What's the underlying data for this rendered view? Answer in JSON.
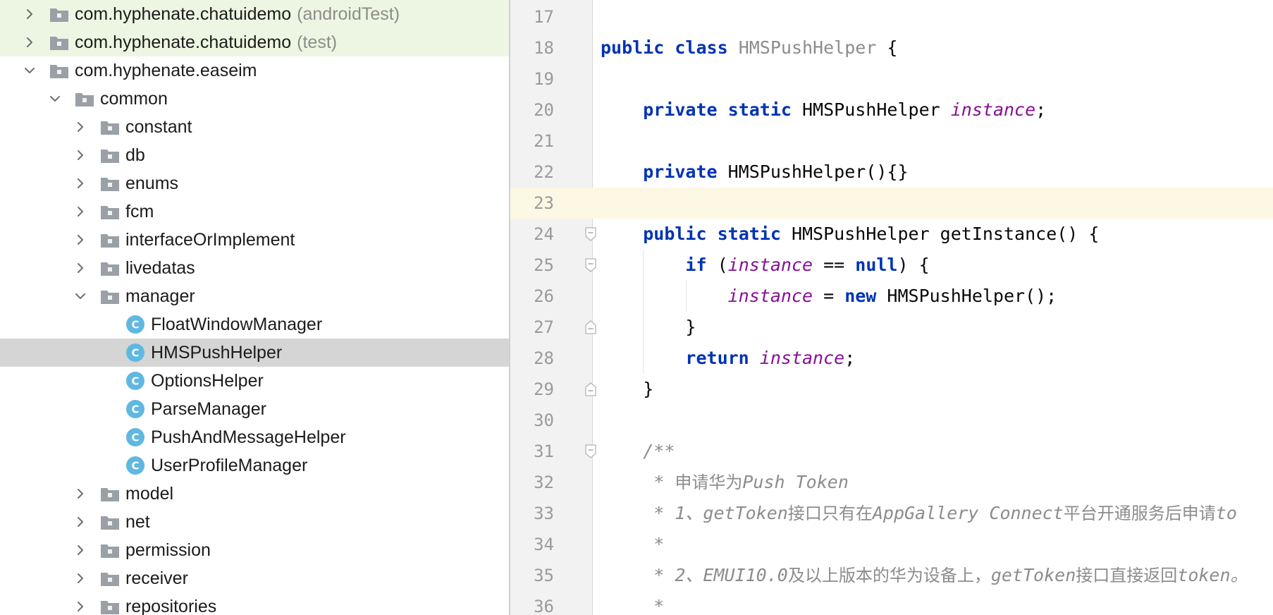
{
  "project_tree": {
    "items": [
      {
        "label": "com.hyphenate.chatuidemo",
        "suffix": "(androidTest)",
        "icon": "package-icon",
        "depth": 0,
        "expanded": false
      },
      {
        "label": "com.hyphenate.chatuidemo",
        "suffix": "(test)",
        "icon": "package-icon",
        "depth": 0,
        "expanded": false
      },
      {
        "label": "com.hyphenate.easeim",
        "suffix": "",
        "icon": "package-icon",
        "depth": 0,
        "expanded": true
      },
      {
        "label": "common",
        "suffix": "",
        "icon": "folder-icon",
        "depth": 1,
        "expanded": true
      },
      {
        "label": "constant",
        "suffix": "",
        "icon": "folder-icon",
        "depth": 2,
        "expanded": false
      },
      {
        "label": "db",
        "suffix": "",
        "icon": "folder-icon",
        "depth": 2,
        "expanded": false
      },
      {
        "label": "enums",
        "suffix": "",
        "icon": "folder-icon",
        "depth": 2,
        "expanded": false
      },
      {
        "label": "fcm",
        "suffix": "",
        "icon": "folder-icon",
        "depth": 2,
        "expanded": false
      },
      {
        "label": "interfaceOrImplement",
        "suffix": "",
        "icon": "folder-icon",
        "depth": 2,
        "expanded": false
      },
      {
        "label": "livedatas",
        "suffix": "",
        "icon": "folder-icon",
        "depth": 2,
        "expanded": false
      },
      {
        "label": "manager",
        "suffix": "",
        "icon": "folder-icon",
        "depth": 2,
        "expanded": true
      },
      {
        "label": "FloatWindowManager",
        "suffix": "",
        "icon": "java-class-icon",
        "depth": 3
      },
      {
        "label": "HMSPushHelper",
        "suffix": "",
        "icon": "java-class-icon",
        "depth": 3,
        "selected": true
      },
      {
        "label": "OptionsHelper",
        "suffix": "",
        "icon": "java-class-icon",
        "depth": 3
      },
      {
        "label": "ParseManager",
        "suffix": "",
        "icon": "java-class-icon",
        "depth": 3
      },
      {
        "label": "PushAndMessageHelper",
        "suffix": "",
        "icon": "java-class-icon",
        "depth": 3
      },
      {
        "label": "UserProfileManager",
        "suffix": "",
        "icon": "java-class-icon",
        "depth": 3
      },
      {
        "label": "model",
        "suffix": "",
        "icon": "folder-icon",
        "depth": 2,
        "expanded": false
      },
      {
        "label": "net",
        "suffix": "",
        "icon": "folder-icon",
        "depth": 2,
        "expanded": false
      },
      {
        "label": "permission",
        "suffix": "",
        "icon": "folder-icon",
        "depth": 2,
        "expanded": false
      },
      {
        "label": "receiver",
        "suffix": "",
        "icon": "folder-icon",
        "depth": 2,
        "expanded": false
      },
      {
        "label": "repositories",
        "suffix": "",
        "icon": "folder-icon",
        "depth": 2,
        "expanded": false
      }
    ]
  },
  "editor": {
    "current_line": "23",
    "lines": [
      {
        "no": "17",
        "tokens": []
      },
      {
        "no": "18",
        "tokens": [
          {
            "t": "public",
            "c": "kw"
          },
          {
            "t": " "
          },
          {
            "t": "class",
            "c": "kw"
          },
          {
            "t": " "
          },
          {
            "t": "HMSPushHelper",
            "c": "cls-decl"
          },
          {
            "t": " {"
          }
        ]
      },
      {
        "no": "19",
        "tokens": []
      },
      {
        "no": "20",
        "tokens": [
          {
            "t": "    "
          },
          {
            "t": "private",
            "c": "kw"
          },
          {
            "t": " "
          },
          {
            "t": "static",
            "c": "kw"
          },
          {
            "t": " HMSPushHelper "
          },
          {
            "t": "instance",
            "c": "fld"
          },
          {
            "t": ";"
          }
        ]
      },
      {
        "no": "21",
        "tokens": []
      },
      {
        "no": "22",
        "tokens": [
          {
            "t": "    "
          },
          {
            "t": "private",
            "c": "kw"
          },
          {
            "t": " HMSPushHelper(){}"
          }
        ]
      },
      {
        "no": "23",
        "tokens": []
      },
      {
        "no": "24",
        "tokens": [
          {
            "t": "    "
          },
          {
            "t": "public",
            "c": "kw"
          },
          {
            "t": " "
          },
          {
            "t": "static",
            "c": "kw"
          },
          {
            "t": " HMSPushHelper getInstance() {"
          }
        ]
      },
      {
        "no": "25",
        "tokens": [
          {
            "t": "        "
          },
          {
            "t": "if",
            "c": "kw"
          },
          {
            "t": " ("
          },
          {
            "t": "instance",
            "c": "fld"
          },
          {
            "t": " == "
          },
          {
            "t": "null",
            "c": "kw"
          },
          {
            "t": ") {"
          }
        ]
      },
      {
        "no": "26",
        "tokens": [
          {
            "t": "            "
          },
          {
            "t": "instance",
            "c": "fld"
          },
          {
            "t": " = "
          },
          {
            "t": "new",
            "c": "kw"
          },
          {
            "t": " HMSPushHelper();"
          }
        ]
      },
      {
        "no": "27",
        "tokens": [
          {
            "t": "        }"
          }
        ]
      },
      {
        "no": "28",
        "tokens": [
          {
            "t": "        "
          },
          {
            "t": "return",
            "c": "kw"
          },
          {
            "t": " "
          },
          {
            "t": "instance",
            "c": "fld"
          },
          {
            "t": ";"
          }
        ]
      },
      {
        "no": "29",
        "tokens": [
          {
            "t": "    }"
          }
        ]
      },
      {
        "no": "30",
        "tokens": []
      },
      {
        "no": "31",
        "tokens": [
          {
            "t": "    "
          },
          {
            "t": "/**",
            "c": "cmt"
          }
        ]
      },
      {
        "no": "32",
        "tokens": [
          {
            "t": "     "
          },
          {
            "t": "* ",
            "c": "cmt"
          },
          {
            "t": "申请华为",
            "c": "cmt-cjk"
          },
          {
            "t": "Push Token",
            "c": "cmt"
          }
        ]
      },
      {
        "no": "33",
        "tokens": [
          {
            "t": "     "
          },
          {
            "t": "* 1、getToken",
            "c": "cmt"
          },
          {
            "t": "接口只有在",
            "c": "cmt-cjk"
          },
          {
            "t": "AppGallery Connect",
            "c": "cmt"
          },
          {
            "t": "平台开通服务后申请",
            "c": "cmt-cjk"
          },
          {
            "t": "to",
            "c": "cmt"
          }
        ]
      },
      {
        "no": "34",
        "tokens": [
          {
            "t": "     "
          },
          {
            "t": "*",
            "c": "cmt"
          }
        ]
      },
      {
        "no": "35",
        "tokens": [
          {
            "t": "     "
          },
          {
            "t": "* 2、EMUI10.0",
            "c": "cmt"
          },
          {
            "t": "及以上版本的华为设备上，",
            "c": "cmt-cjk"
          },
          {
            "t": "getToken",
            "c": "cmt"
          },
          {
            "t": "接口直接返回",
            "c": "cmt-cjk"
          },
          {
            "t": "token。",
            "c": "cmt"
          }
        ]
      },
      {
        "no": "36",
        "tokens": [
          {
            "t": "     "
          },
          {
            "t": "*",
            "c": "cmt"
          }
        ]
      }
    ]
  },
  "colors": {
    "keyword": "#0033b3",
    "field": "#871094",
    "comment": "#8c8c8c",
    "tree_tint": "#edf6e3",
    "selection": "#d5d5d5",
    "caret_row": "#fdf8e4"
  }
}
